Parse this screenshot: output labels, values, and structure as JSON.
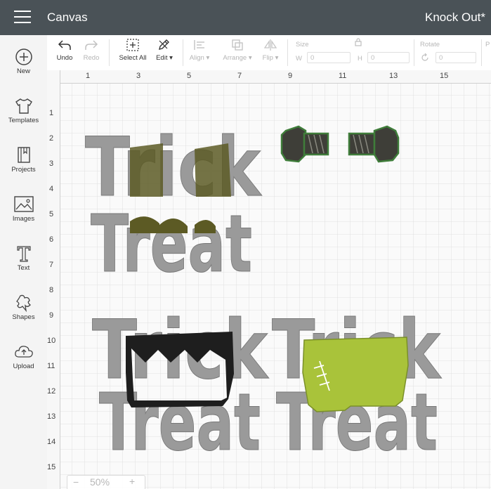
{
  "header": {
    "app_title": "Canvas",
    "project_name": "Knock Out*"
  },
  "sidebar": {
    "items": [
      {
        "label": "New",
        "icon": "plus-circle-icon"
      },
      {
        "label": "Templates",
        "icon": "tshirt-icon"
      },
      {
        "label": "Projects",
        "icon": "book-icon"
      },
      {
        "label": "Images",
        "icon": "image-icon"
      },
      {
        "label": "Text",
        "icon": "text-icon"
      },
      {
        "label": "Shapes",
        "icon": "shapes-icon"
      },
      {
        "label": "Upload",
        "icon": "cloud-upload-icon"
      }
    ]
  },
  "toolbar": {
    "undo": "Undo",
    "redo": "Redo",
    "select_all": "Select All",
    "edit": "Edit",
    "align": "Align",
    "arrange": "Arrange",
    "flip": "Flip",
    "size": "Size",
    "w": "W",
    "h": "H",
    "rotate": "Rotate",
    "w_value": "0",
    "h_value": "0",
    "rotate_value": "0"
  },
  "ruler": {
    "top": [
      "1",
      "3",
      "5",
      "7",
      "9",
      "11",
      "13",
      "15"
    ],
    "left": [
      "1",
      "2",
      "3",
      "4",
      "5",
      "6",
      "7",
      "8",
      "9",
      "10",
      "11",
      "12",
      "13",
      "14",
      "15"
    ]
  },
  "canvas": {
    "words": {
      "trick": "Trick",
      "treat": "Treat"
    },
    "colors": {
      "gray": "#9a9a9a",
      "olive": "#5c5a24",
      "bolt": "#3e3e38",
      "bolt_outline": "#3f7d3a",
      "black": "#1e1e1e",
      "lime": "#a9c33a"
    }
  },
  "zoom": {
    "level": "50%",
    "minus": "−",
    "plus": "+"
  }
}
